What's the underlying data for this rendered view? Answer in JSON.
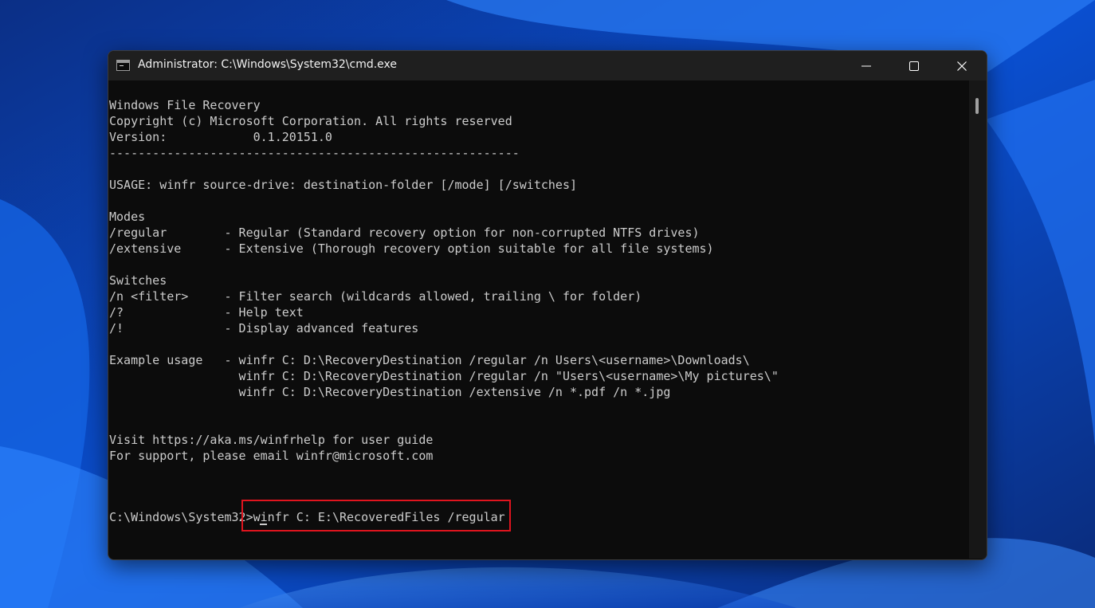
{
  "window": {
    "title": "Administrator: C:\\Windows\\System32\\cmd.exe",
    "controls": {
      "minimize_icon": "minimize-icon",
      "maximize_icon": "maximize-icon",
      "close_icon": "close-icon"
    }
  },
  "console": {
    "lines": [
      "Windows File Recovery",
      "Copyright (c) Microsoft Corporation. All rights reserved",
      "Version:            0.1.20151.0",
      "---------------------------------------------------------",
      "",
      "USAGE: winfr source-drive: destination-folder [/mode] [/switches]",
      "",
      "Modes",
      "/regular        - Regular (Standard recovery option for non-corrupted NTFS drives)",
      "/extensive      - Extensive (Thorough recovery option suitable for all file systems)",
      "",
      "Switches",
      "/n <filter>     - Filter search (wildcards allowed, trailing \\ for folder)",
      "/?              - Help text",
      "/!              - Display advanced features",
      "",
      "Example usage   - winfr C: D:\\RecoveryDestination /regular /n Users\\<username>\\Downloads\\",
      "                  winfr C: D:\\RecoveryDestination /regular /n \"Users\\<username>\\My pictures\\\"",
      "                  winfr C: D:\\RecoveryDestination /extensive /n *.pdf /n *.jpg",
      "",
      "",
      "Visit https://aka.ms/winfrhelp for user guide",
      "For support, please email winfr@microsoft.com"
    ],
    "prompt": "C:\\Windows\\System32>",
    "command": "winfr C: E:\\RecoveredFiles /regular"
  },
  "colors": {
    "console_bg": "#0c0c0c",
    "console_text": "#cccccc",
    "titlebar_bg": "#1f1f1f",
    "highlight": "#e0141e"
  }
}
